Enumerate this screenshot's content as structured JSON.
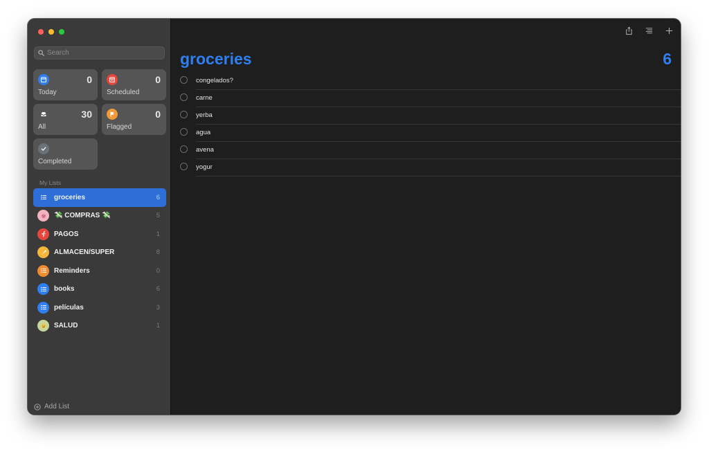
{
  "sidebar": {
    "search_placeholder": "Search",
    "smart_lists": [
      {
        "label": "Today",
        "count": "0",
        "icon": "calendar-today-icon",
        "color": "#2f7ff0"
      },
      {
        "label": "Scheduled",
        "count": "0",
        "icon": "calendar-scheduled-icon",
        "color": "#e5473e"
      },
      {
        "label": "All",
        "count": "30",
        "icon": "tray-icon",
        "color": "#555555"
      },
      {
        "label": "Flagged",
        "count": "0",
        "icon": "flag-icon",
        "color": "#f19a37"
      },
      {
        "label": "Completed",
        "count": "",
        "icon": "checkmark-icon",
        "color": "#6c7178"
      }
    ],
    "section_title": "My Lists",
    "lists": [
      {
        "name": "groceries",
        "count": "6",
        "icon": "list-icon",
        "color": "#2d6fd6",
        "selected": true
      },
      {
        "name": "💸 COMPRAS 💸",
        "count": "5",
        "icon": "pig-face-icon",
        "color": "#f3b3c0"
      },
      {
        "name": "PAGOS",
        "count": "1",
        "icon": "running-person-icon",
        "color": "#e5473e"
      },
      {
        "name": "ALMACEN/SUPER",
        "count": "8",
        "icon": "carrot-icon",
        "color": "#f3b53a"
      },
      {
        "name": "Reminders",
        "count": "0",
        "icon": "list-icon",
        "color": "#f08c2f"
      },
      {
        "name": "books",
        "count": "6",
        "icon": "list-icon",
        "color": "#2f7ff0"
      },
      {
        "name": "películas",
        "count": "3",
        "icon": "list-icon",
        "color": "#2f7ff0"
      },
      {
        "name": "SALUD",
        "count": "1",
        "icon": "smiley-face-icon",
        "color": "#c7d69a"
      }
    ],
    "add_list_label": "Add List"
  },
  "main": {
    "title": "groceries",
    "count": "6",
    "accent": "#2f7ff0",
    "toolbar": [
      "share-icon",
      "view-options-icon",
      "add-icon"
    ],
    "items": [
      "congelados?",
      "carne",
      "yerba",
      "agua",
      "avena",
      "yogur"
    ]
  }
}
